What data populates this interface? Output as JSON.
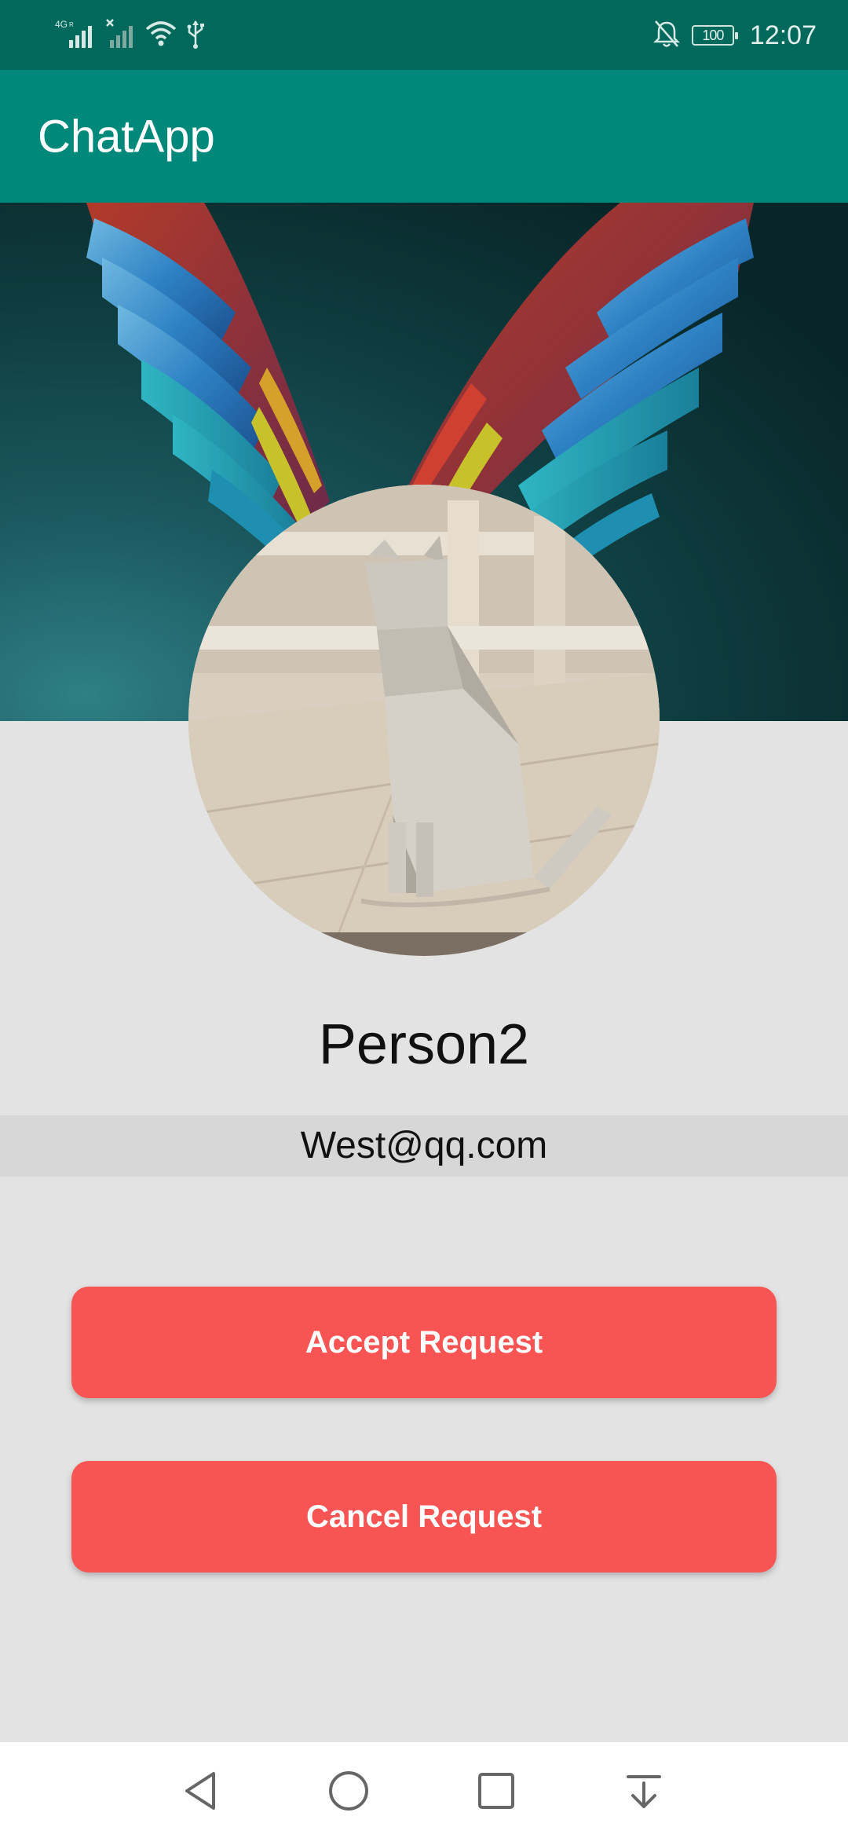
{
  "status_bar": {
    "network_label": "4G",
    "time": "12:07",
    "battery_level": "100",
    "icons": [
      "signal-icon",
      "signal-no-sim-icon",
      "wifi-icon",
      "usb-icon",
      "notifications-off-icon",
      "battery-icon"
    ]
  },
  "app_bar": {
    "title": "ChatApp"
  },
  "profile": {
    "name": "Person2",
    "email": "West@qq.com",
    "cover_image": "parrot-wings-image",
    "avatar_image": "paper-cat-image"
  },
  "actions": {
    "accept_label": "Accept Request",
    "cancel_label": "Cancel Request"
  },
  "nav_bar": {
    "icons": [
      "back-icon",
      "home-icon",
      "recents-icon",
      "notification-shade-icon"
    ]
  },
  "colors": {
    "status_bar": "#00695c",
    "app_bar": "#00897b",
    "button": "#f95454",
    "background": "#e3e3e3"
  }
}
